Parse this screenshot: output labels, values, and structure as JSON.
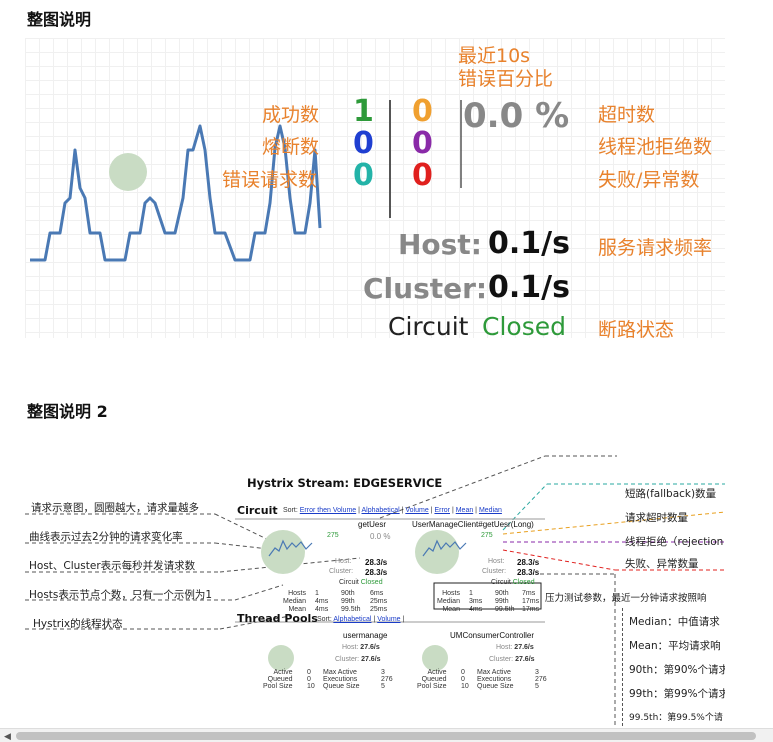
{
  "section1": {
    "title": "整图说明",
    "label_error_pct": "最近10s\n错误百分比",
    "labels_left": [
      "成功数",
      "熔断数",
      "错误请求数"
    ],
    "counts_col1": [
      "1",
      "0",
      "0"
    ],
    "counts_col2": [
      "0",
      "0",
      "0"
    ],
    "error_pct": "0.0 %",
    "labels_right": [
      "超时数",
      "线程池拒绝数",
      "失败/异常数"
    ],
    "host_label": "Host:",
    "host_value": "0.1/s",
    "cluster_label": "Cluster:",
    "cluster_value": "0.1/s",
    "circuit_label": "Circuit",
    "circuit_value": "Closed",
    "rate_label": "服务请求频率",
    "circuit_state_label": "断路状态"
  },
  "section2": {
    "title": "整图说明 2",
    "stream_title": "Hystrix Stream: EDGESERVICE",
    "circuit_heading": "Circuit",
    "sort_prefix": "Sort:",
    "sort_links": [
      "Error then Volume",
      "Alphabetical",
      "Volume",
      "Error",
      "Mean",
      "Median"
    ],
    "sort_links_2": [
      "Alphabetical",
      "Volume"
    ],
    "circuits": [
      {
        "name": "getUesr",
        "success": "275",
        "pct": "0.0 %",
        "host": "28.3/s",
        "cluster": "28.3/s",
        "state_label": "Circuit",
        "state": "Closed",
        "hosts": "1",
        "p90": "6ms",
        "median": "4ms",
        "p99": "25ms",
        "mean": "4ms",
        "p995": "25ms"
      },
      {
        "name": "UserManageClient#getUesr(Long)",
        "success": "275",
        "pct": "0.0 %",
        "host": "28.3/s",
        "cluster": "28.3/s",
        "state_label": "Circuit",
        "state": "Closed",
        "hosts": "1",
        "p90": "7ms",
        "median": "3ms",
        "p99": "17ms",
        "mean": "4ms",
        "p995": "17ms"
      }
    ],
    "stat_keys": {
      "hosts": "Hosts",
      "median": "Median",
      "mean": "Mean",
      "p90": "90th",
      "p99": "99th",
      "p995": "99.5th",
      "host": "Host:",
      "cluster": "Cluster:"
    },
    "thread_pools_heading": "Thread Pools",
    "pools": [
      {
        "name": "usermanage",
        "host": "27.6/s",
        "cluster": "27.6/s",
        "active": "0",
        "queued": "0",
        "pool_size": "10",
        "max_active": "3",
        "executions": "276",
        "queue_size": "5"
      },
      {
        "name": "UMConsumerController",
        "host": "27.6/s",
        "cluster": "27.6/s",
        "active": "0",
        "queued": "0",
        "pool_size": "10",
        "max_active": "3",
        "executions": "276",
        "queue_size": "5"
      }
    ],
    "pool_keys": {
      "active": "Active",
      "queued": "Queued",
      "pool_size": "Pool Size",
      "max_active": "Max Active",
      "executions": "Executions",
      "queue_size": "Queue Size"
    },
    "notes_left": [
      "请求示意图，圆圈越大，请求量越多",
      "曲线表示过去2分钟的请求变化率",
      "Host、Cluster表示每秒并发请求数",
      "Hosts表示节点个数，只有一个示例为1",
      "Hystrix的线程状态"
    ],
    "notes_right": [
      "短路(fallback)数量",
      "请求超时数量",
      "线程拒绝（rejection",
      "失败、异常数量",
      "压力测试参数，最近一分钟请求按照响"
    ],
    "legend_box": [
      "Median：中值请求",
      "Mean：平均请求响",
      "90th：第90%个请求",
      "99th：第99%个请求",
      "99.5th：第99.5%个请"
    ]
  },
  "colors": {
    "orange": "#e8822d",
    "green": "#2e9a3a",
    "blue": "#1f3fd1",
    "purple": "#8a2aa8",
    "red": "#e0201e",
    "gray": "#888888",
    "curve": "#4a79b4",
    "circle": "#c9dcc4"
  }
}
